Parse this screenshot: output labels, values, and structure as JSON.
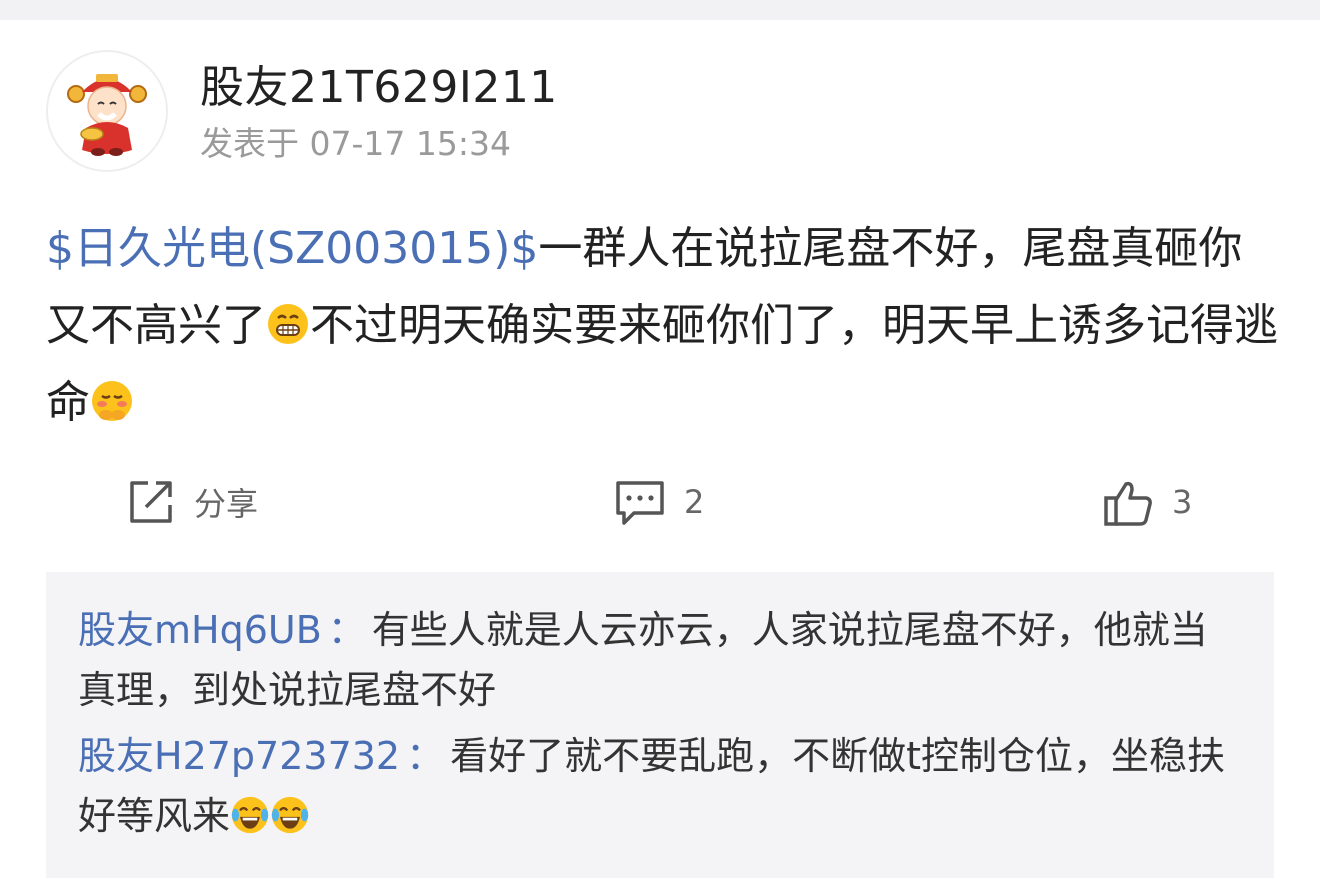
{
  "post": {
    "username": "股友21T629I211",
    "time": "发表于 07-17 15:34",
    "stock_tag": "$日久光电(SZ003015)$",
    "text_part1": "一群人在说拉尾盘不好，尾盘真砸你又不高兴了",
    "text_part2": "不过明天确实要来砸你们了，明天早上诱多记得逃命"
  },
  "actions": {
    "share_label": "分享",
    "comment_count": "2",
    "like_count": "3"
  },
  "comments": [
    {
      "name": "股友mHq6UB",
      "sep": "：",
      "text": "有些人就是人云亦云，人家说拉尾盘不好，他就当真理，到处说拉尾盘不好"
    },
    {
      "name": "股友H27p723732",
      "sep": "：",
      "text": "看好了就不要乱跑，不断做t控制仓位，坐稳扶好等风来"
    }
  ],
  "colors": {
    "link": "#4a6fb5",
    "muted": "#9a9a9a",
    "comment_bg": "#f4f4f6"
  }
}
